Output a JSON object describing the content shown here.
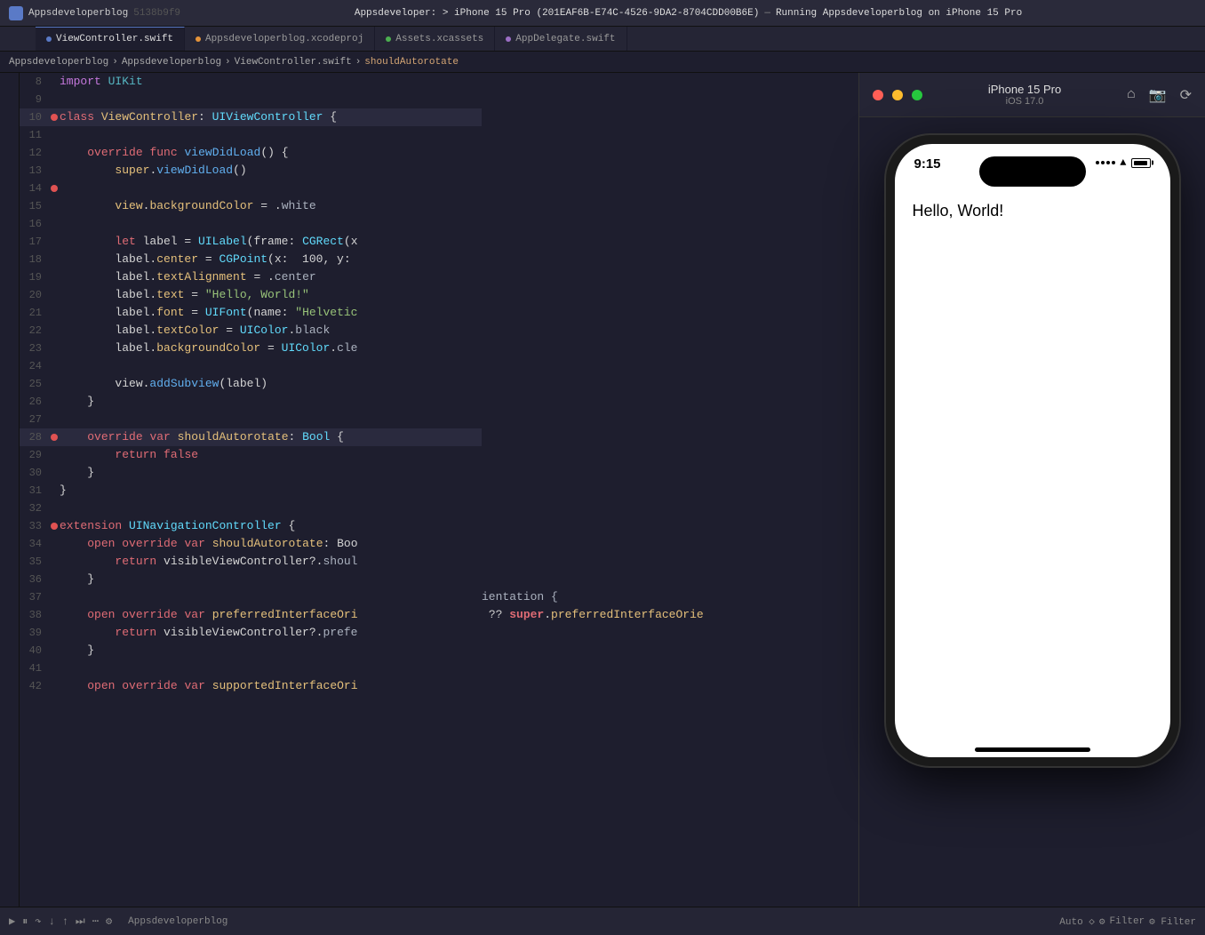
{
  "titlebar": {
    "app_name": "Appsdeveloperblog",
    "app_subtitle": "5138b9f9",
    "breadcrumb_path": "Appsdeveloperblog > Appsdeveloperblog > ViewController.swift > shouldAutorotate",
    "device_info": "Appsdeveloper: > iPhone 15 Pro (201EAF6B-E74C-4526-9DA2-8704CDD00B6E)",
    "running_label": "Running Appsdeveloperblog on iPhone 15 Pro"
  },
  "tabs": [
    {
      "label": "ViewController.swift",
      "active": true,
      "dot_color": "blue"
    },
    {
      "label": "Appsdeveloperblog.xcodeproj",
      "active": false,
      "dot_color": "none"
    },
    {
      "label": "Assets.xcassets",
      "active": false,
      "dot_color": "none"
    },
    {
      "label": "AppDelegate.swift",
      "active": false,
      "dot_color": "none"
    }
  ],
  "breadcrumb": {
    "parts": [
      "Appsdeveloperblog",
      "Appsdeveloperblog",
      "ViewController.swift",
      "shouldAutorotate"
    ]
  },
  "code": {
    "lines": [
      {
        "num": 8,
        "text": "import UIKit",
        "indicator": false
      },
      {
        "num": 9,
        "text": "",
        "indicator": false
      },
      {
        "num": 10,
        "text": "class ViewController: UIViewController {",
        "indicator": true,
        "active": true
      },
      {
        "num": 11,
        "text": "",
        "indicator": false
      },
      {
        "num": 12,
        "text": "    override func viewDidLoad() {",
        "indicator": false
      },
      {
        "num": 13,
        "text": "        super.viewDidLoad()",
        "indicator": false
      },
      {
        "num": 14,
        "text": "",
        "indicator": true
      },
      {
        "num": 15,
        "text": "        view.backgroundColor = .white",
        "indicator": false
      },
      {
        "num": 16,
        "text": "",
        "indicator": false
      },
      {
        "num": 17,
        "text": "        let label = UILabel(frame: CGRect(x",
        "indicator": false
      },
      {
        "num": 18,
        "text": "        label.center = CGPoint(x:  100, y:",
        "indicator": false
      },
      {
        "num": 19,
        "text": "        label.textAlignment = .center",
        "indicator": false
      },
      {
        "num": 20,
        "text": "        label.text = \"Hello, World!\"",
        "indicator": false
      },
      {
        "num": 21,
        "text": "        label.font = UIFont(name: \"Helvetic",
        "indicator": false
      },
      {
        "num": 22,
        "text": "        label.textColor = UIColor.black",
        "indicator": false
      },
      {
        "num": 23,
        "text": "        label.backgroundColor = UIColor.cle",
        "indicator": false
      },
      {
        "num": 24,
        "text": "",
        "indicator": false
      },
      {
        "num": 25,
        "text": "        view.addSubview(label)",
        "indicator": false
      },
      {
        "num": 26,
        "text": "    }",
        "indicator": false
      },
      {
        "num": 27,
        "text": "",
        "indicator": false
      },
      {
        "num": 28,
        "text": "    override var shouldAutorotate: Bool {",
        "indicator": true,
        "active": true
      },
      {
        "num": 29,
        "text": "        return false",
        "indicator": false
      },
      {
        "num": 30,
        "text": "    }",
        "indicator": false
      },
      {
        "num": 31,
        "text": "}",
        "indicator": false
      },
      {
        "num": 32,
        "text": "",
        "indicator": false
      },
      {
        "num": 33,
        "text": "extension UINavigationController {",
        "indicator": true
      },
      {
        "num": 34,
        "text": "    open override var shouldAutorotate: Boo",
        "indicator": false
      },
      {
        "num": 35,
        "text": "        return visibleViewController?.shoul",
        "indicator": false
      },
      {
        "num": 36,
        "text": "    }",
        "indicator": false
      },
      {
        "num": 37,
        "text": "",
        "indicator": false
      },
      {
        "num": 38,
        "text": "    open override var preferredInterfaceOri",
        "indicator": false
      },
      {
        "num": 39,
        "text": "        return visibleViewController?.prefe",
        "indicator": false
      },
      {
        "num": 40,
        "text": "    }",
        "indicator": false
      },
      {
        "num": 41,
        "text": "",
        "indicator": false
      },
      {
        "num": 42,
        "text": "    open override var supportedInterfaceOri",
        "indicator": false
      }
    ]
  },
  "simulator": {
    "toolbar": {
      "title": "iPhone 15 Pro",
      "subtitle": "iOS 17.0",
      "traffic_lights": [
        "red",
        "yellow",
        "green"
      ]
    },
    "phone": {
      "status_time": "9:15",
      "hello_text": "Hello, World!"
    }
  },
  "bottom_toolbar": {
    "left_label": "Auto ◇",
    "filter_label": "Filter",
    "filter_right": "Filter"
  }
}
